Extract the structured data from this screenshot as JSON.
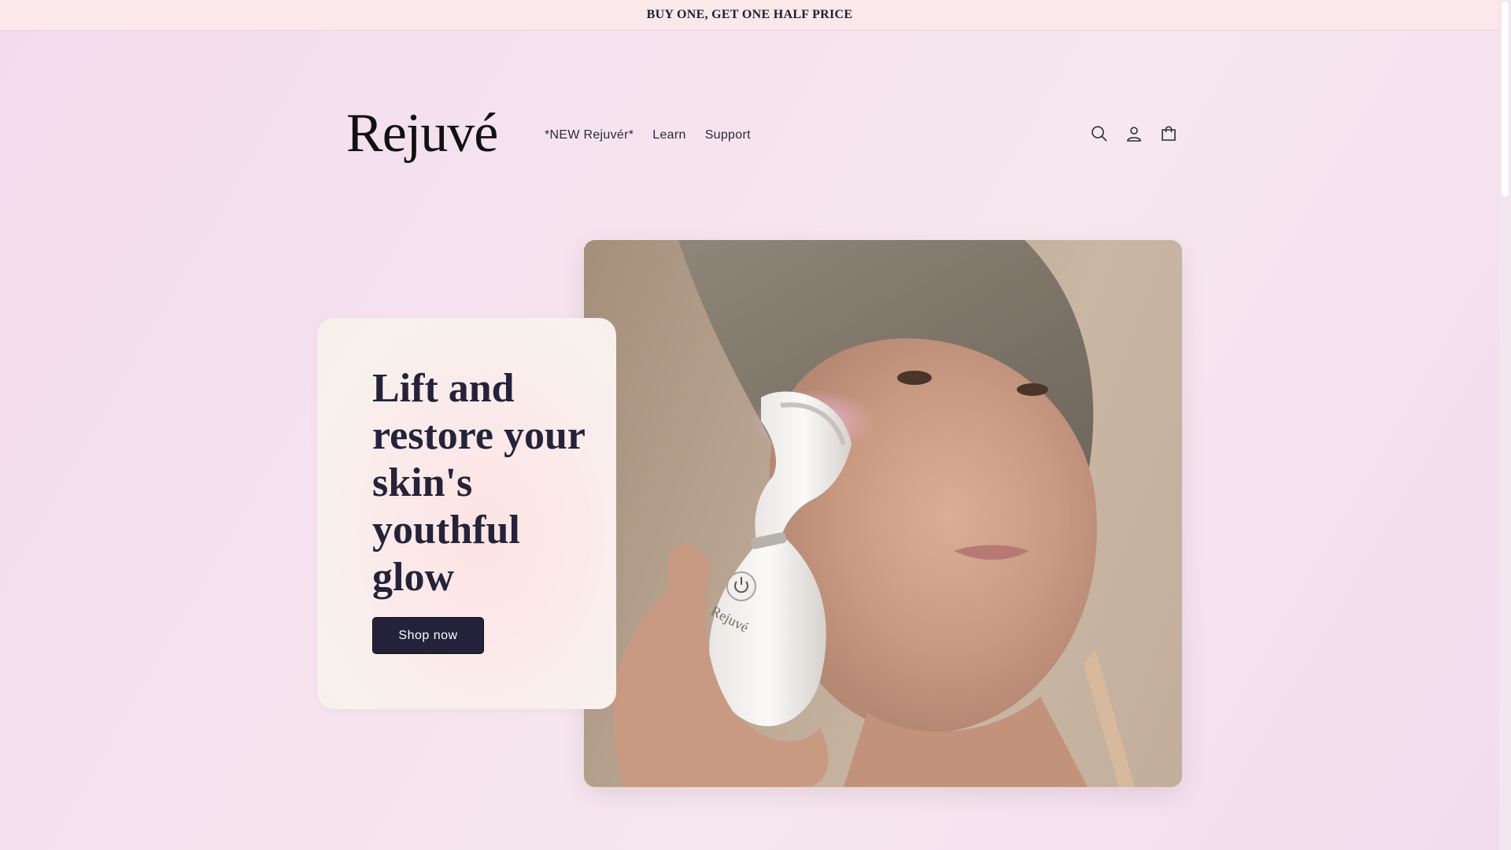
{
  "announcement": {
    "text": "BUY ONE, GET ONE HALF PRICE"
  },
  "header": {
    "logo": "Rejuvé",
    "nav": [
      {
        "label": "*NEW Rejuvér*"
      },
      {
        "label": "Learn"
      },
      {
        "label": "Support"
      }
    ],
    "icons": [
      "search-icon",
      "account-icon",
      "cart-icon"
    ]
  },
  "hero": {
    "title": "Lift and restore your skin's youthful glow",
    "button_label": "Shop now",
    "device_brand": "Rejuvé"
  },
  "colors": {
    "accent": "#23223a",
    "announcement_bg": "#fbe8ea",
    "page_bg": "#f3dcee"
  }
}
